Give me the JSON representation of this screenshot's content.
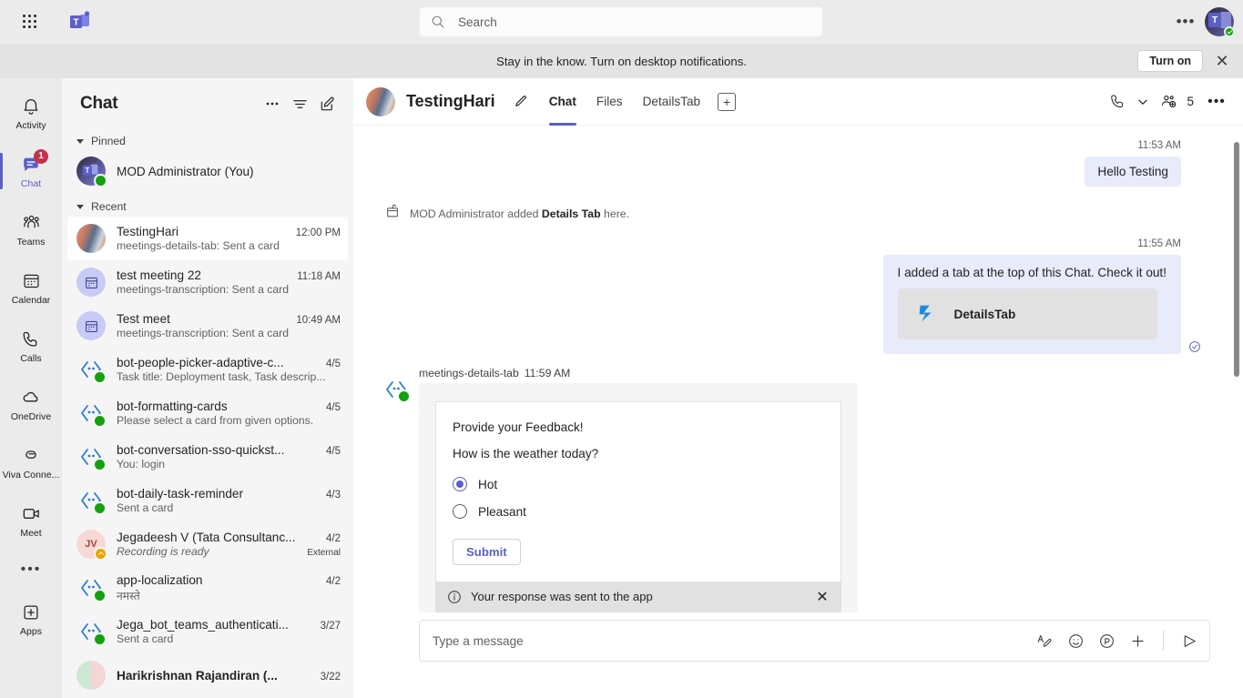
{
  "topbar": {
    "waffle_label": "app-launcher",
    "app_logo": "teams-logo",
    "search": {
      "placeholder": "Search",
      "value": "",
      "icon": "search-icon"
    },
    "more_label": "•••",
    "avatar_initial": "T",
    "presence": "available"
  },
  "banner": {
    "text": "Stay in the know. Turn on desktop notifications.",
    "button": "Turn on",
    "close": "✕"
  },
  "rail": {
    "items": [
      {
        "label": "Activity",
        "icon": "bell-icon",
        "active": false,
        "badge": ""
      },
      {
        "label": "Chat",
        "icon": "chat-icon",
        "active": true,
        "badge": "1"
      },
      {
        "label": "Teams",
        "icon": "teams-icon",
        "active": false,
        "badge": ""
      },
      {
        "label": "Calendar",
        "icon": "calendar-icon",
        "active": false,
        "badge": ""
      },
      {
        "label": "Calls",
        "icon": "phone-icon",
        "active": false,
        "badge": ""
      },
      {
        "label": "OneDrive",
        "icon": "cloud-icon",
        "active": false,
        "badge": ""
      },
      {
        "label": "Viva Conne...",
        "icon": "viva-connections-icon",
        "active": false,
        "badge": ""
      },
      {
        "label": "Meet",
        "icon": "video-camera-icon",
        "active": false,
        "badge": ""
      }
    ],
    "more": "•••",
    "apps": {
      "label": "Apps",
      "icon": "apps-plus-icon"
    }
  },
  "chatlist": {
    "title": "Chat",
    "actions": [
      "more-icon",
      "filter-icon",
      "compose-chat-icon"
    ],
    "sections": [
      {
        "name": "Pinned",
        "items": [
          {
            "name": "MOD Administrator (You)",
            "time": "",
            "preview": "",
            "avatar": "teams-photo",
            "presence": "available",
            "selected": false,
            "single": true
          }
        ]
      },
      {
        "name": "Recent",
        "items": [
          {
            "name": "TestingHari",
            "time": "12:00 PM",
            "preview": "meetings-details-tab: Sent a card",
            "avatar": "photo",
            "presence": "",
            "selected": true,
            "single": false
          },
          {
            "name": "test meeting 22",
            "time": "11:18 AM",
            "preview": "meetings-transcription: Sent a card",
            "avatar": "meeting",
            "presence": "",
            "selected": false,
            "single": false
          },
          {
            "name": "Test meet",
            "time": "10:49 AM",
            "preview": "meetings-transcription: Sent a card",
            "avatar": "meeting",
            "presence": "",
            "selected": false,
            "single": false
          },
          {
            "name": "bot-people-picker-adaptive-c...",
            "time": "4/5",
            "preview": "Task title: Deployment task, Task descrip...",
            "avatar": "bot",
            "presence": "available",
            "selected": false,
            "single": false
          },
          {
            "name": "bot-formatting-cards",
            "time": "4/5",
            "preview": "Please select a card from given options.",
            "avatar": "bot",
            "presence": "available",
            "selected": false,
            "single": false
          },
          {
            "name": "bot-conversation-sso-quickst...",
            "time": "4/5",
            "preview": "You: login",
            "avatar": "bot",
            "presence": "available",
            "selected": false,
            "single": false
          },
          {
            "name": "bot-daily-task-reminder",
            "time": "4/3",
            "preview": "Sent a card",
            "avatar": "bot",
            "presence": "available",
            "selected": false,
            "single": false
          },
          {
            "name": "Jegadeesh V (Tata Consultanc...",
            "time": "4/2",
            "preview": "Recording is ready",
            "preview_italic": true,
            "tag": "External",
            "avatar": "initials",
            "initials": "JV",
            "presence": "away",
            "selected": false,
            "single": false
          },
          {
            "name": "app-localization",
            "time": "4/2",
            "preview": "नमस्ते",
            "avatar": "bot",
            "presence": "available",
            "selected": false,
            "single": false
          },
          {
            "name": "Jega_bot_teams_authenticati...",
            "time": "3/27",
            "preview": "Sent a card",
            "avatar": "bot",
            "presence": "available",
            "selected": false,
            "single": false
          },
          {
            "name": "Harikrishnan Rajandiran (...",
            "time": "3/22",
            "preview": "",
            "avatar": "split",
            "presence": "",
            "selected": false,
            "single": false,
            "bold": true
          }
        ]
      }
    ]
  },
  "conversation": {
    "header": {
      "title": "TestingHari",
      "edit_icon": "pencil-icon",
      "tabs": [
        {
          "label": "Chat",
          "active": true
        },
        {
          "label": "Files",
          "active": false
        },
        {
          "label": "DetailsTab",
          "active": false
        }
      ],
      "add_tab": "+",
      "call_icon": "call-icon",
      "call_chevron": "chevron-down-icon",
      "people_icon": "add-people-icon",
      "people_count": "5",
      "more": "•••"
    },
    "messages": [
      {
        "kind": "outgoing",
        "time": "11:53 AM",
        "text": "Hello Testing"
      },
      {
        "kind": "system",
        "icon": "tab-added-icon",
        "text_before": "MOD Administrator added ",
        "text_bold": "Details Tab",
        "text_after": " here."
      },
      {
        "kind": "outgoing-card",
        "time": "11:55 AM",
        "text": "I added a tab at the top of this Chat. Check it out!",
        "card_name": "DetailsTab",
        "card_icon": "power-apps-icon",
        "read_receipt": "read-receipt-icon"
      },
      {
        "kind": "bot-card",
        "sender": "meetings-details-tab",
        "time": "11:59 AM",
        "card": {
          "title": "Provide your Feedback!",
          "question": "How is the weather today?",
          "options": [
            {
              "label": "Hot",
              "selected": true
            },
            {
              "label": "Pleasant",
              "selected": false
            }
          ],
          "submit": "Submit",
          "footer_text": "Your response was sent to the app",
          "footer_icon": "info-icon",
          "footer_close": "✕"
        }
      }
    ],
    "compose": {
      "placeholder": "Type a message",
      "value": "",
      "icons": [
        "format-icon",
        "emoji-icon",
        "sticker-icon",
        "attach-plus-icon",
        "send-icon"
      ]
    }
  },
  "colors": {
    "accent": "#5b5fc7",
    "bubble_out": "#e8ebfa",
    "badge_red": "#c4314b",
    "presence_green": "#13a10e",
    "presence_away": "#eaa300",
    "rail_bg": "#ebebeb",
    "list_bg": "#f5f5f5"
  }
}
